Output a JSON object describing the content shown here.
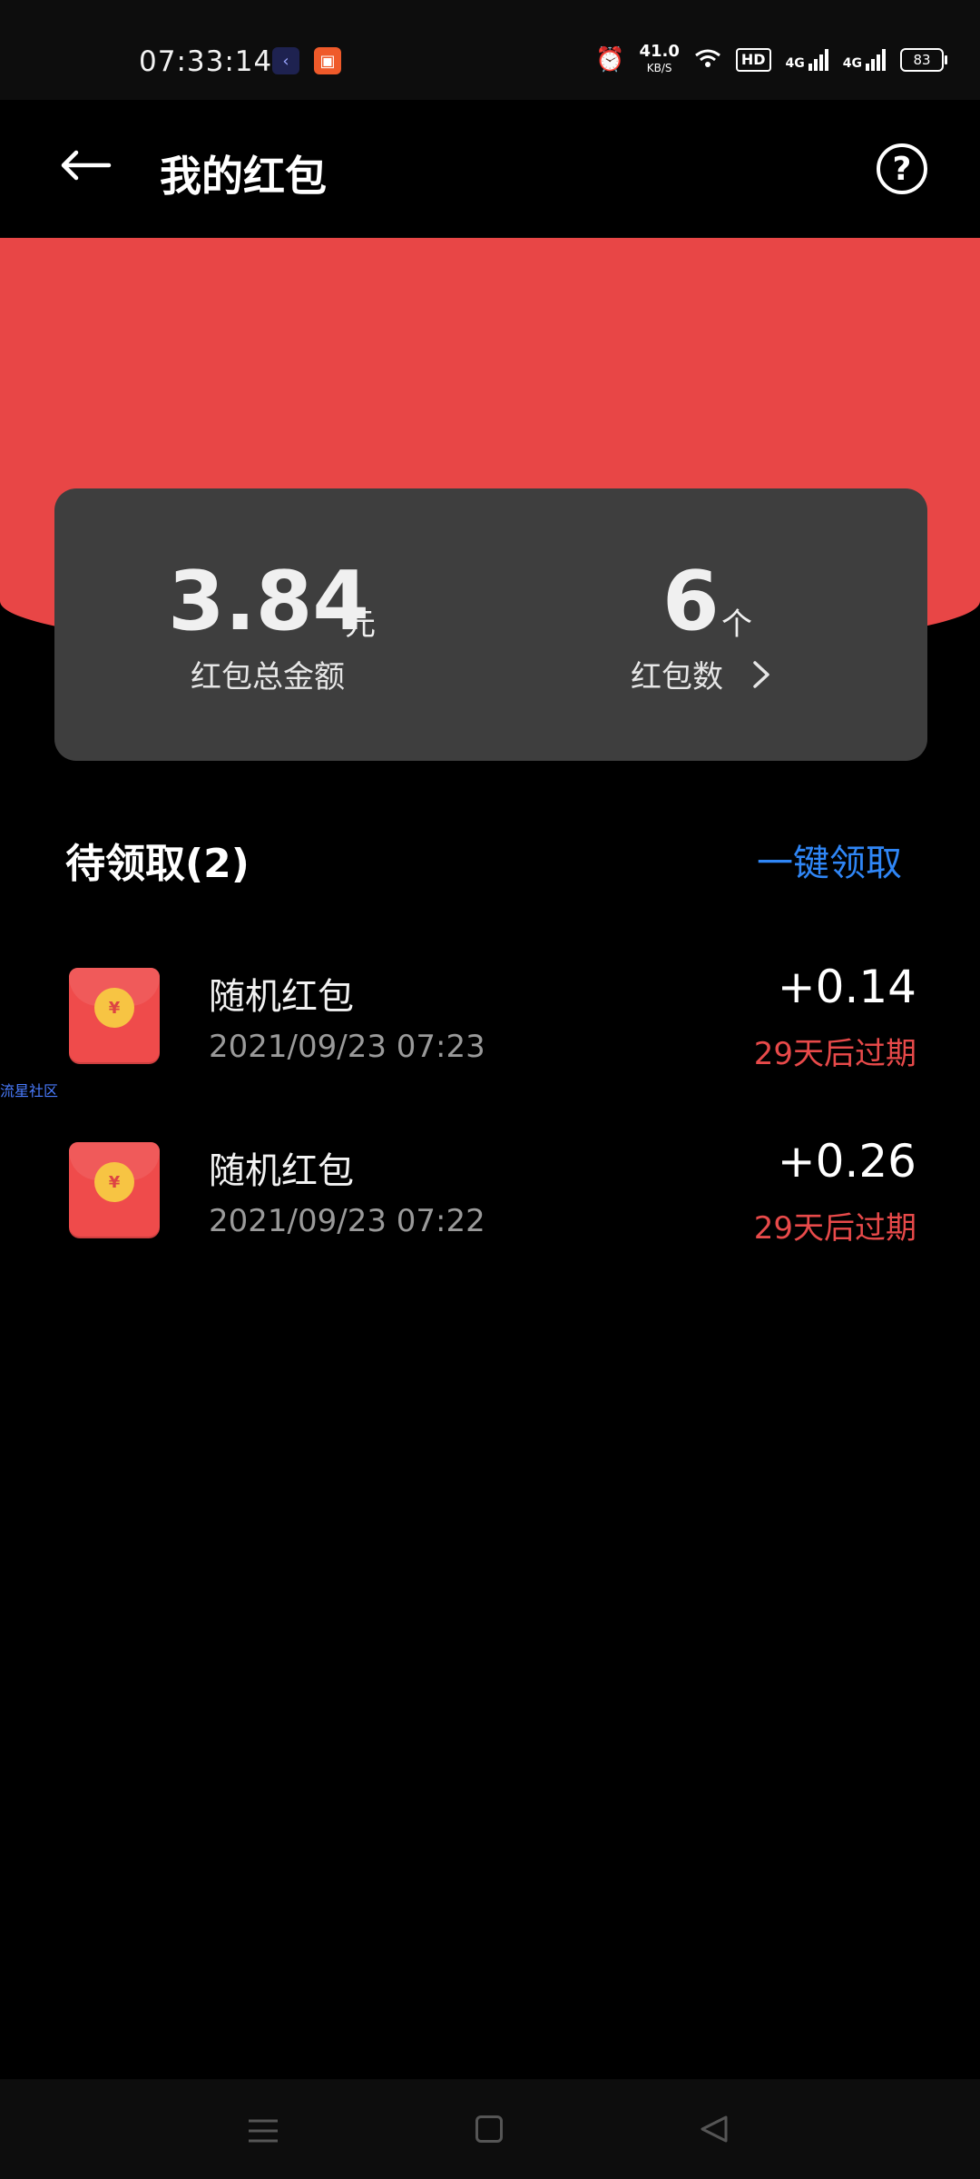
{
  "status_bar": {
    "time": "07:33:14",
    "net_speed": "41.0",
    "net_unit": "KB/S",
    "hd_label": "HD",
    "sig1_label": "4G",
    "sig2_label": "4G",
    "battery": "83"
  },
  "header": {
    "title": "我的红包"
  },
  "summary": {
    "total_amount": "3.84",
    "total_unit": "元",
    "total_label": "红包总金额",
    "count_value": "6",
    "count_unit": "个",
    "count_label": "红包数"
  },
  "pending": {
    "section_title": "待领取(2)",
    "claim_all_label": "一键领取",
    "items": [
      {
        "title": "随机红包",
        "date": "2021/09/23 07:23",
        "amount": "+0.14",
        "expire": "29天后过期"
      },
      {
        "title": "随机红包",
        "date": "2021/09/23 07:22",
        "amount": "+0.26",
        "expire": "29天后过期"
      }
    ]
  },
  "watermark": "流星社区",
  "colors": {
    "accent_red": "#e84646",
    "link_blue": "#2f86f6",
    "card_bg": "#3e3e3e"
  }
}
